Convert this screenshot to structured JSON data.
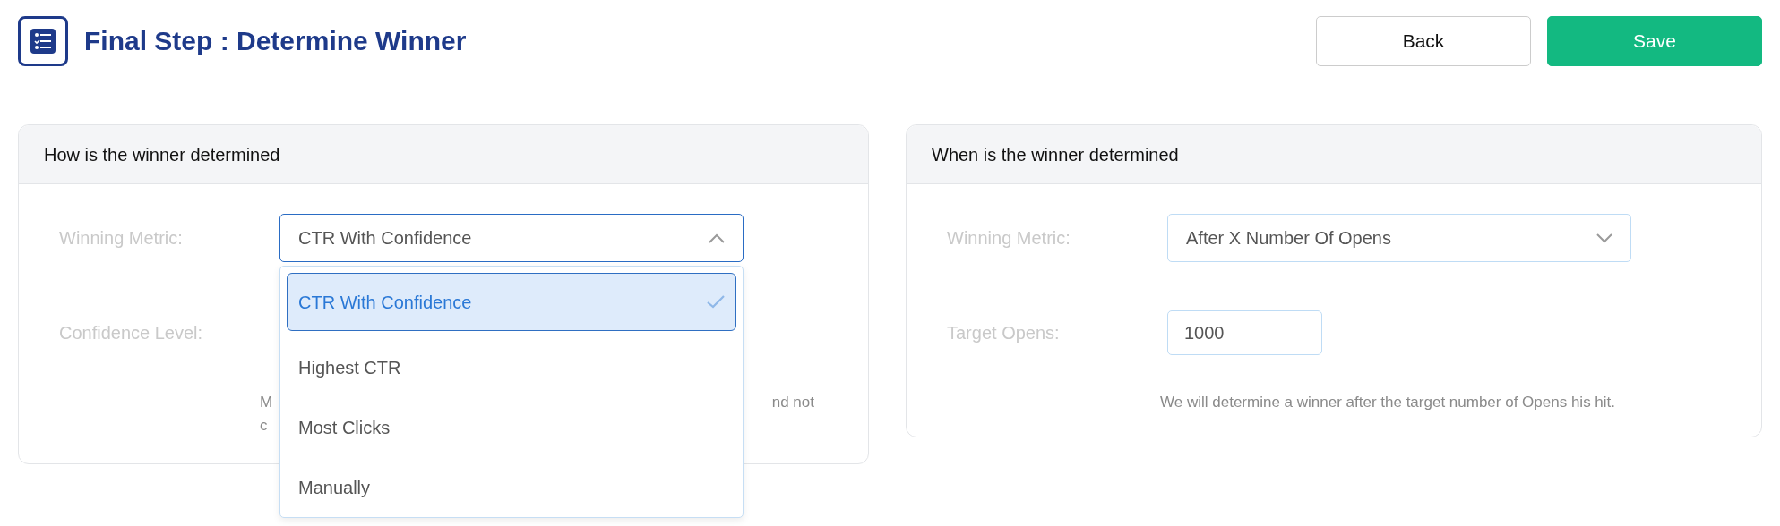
{
  "page": {
    "title": "Final Step : Determine Winner"
  },
  "buttons": [
    {
      "label": "Back",
      "kind": "secondary"
    },
    {
      "label": "Save",
      "kind": "primary"
    }
  ],
  "panels": [
    {
      "title": "How is the winner determined",
      "fields": [
        {
          "kind": "select",
          "label": "Winning Metric:",
          "value": "CTR With Confidence",
          "expanded": true,
          "options": [
            {
              "label": "CTR With Confidence",
              "selected": true
            },
            {
              "label": "Highest CTR",
              "selected": false
            },
            {
              "label": "Most Clicks",
              "selected": false
            },
            {
              "label": "Manually",
              "selected": false
            }
          ]
        },
        {
          "kind": "covered",
          "label": "Confidence Level:"
        }
      ],
      "help_covered": {
        "line_1_start": "M",
        "line_1_end": "nd not",
        "line_2_start": "c"
      }
    },
    {
      "title": "When is the winner determined",
      "fields": [
        {
          "kind": "select",
          "label": "Winning Metric:",
          "value": "After X Number Of Opens",
          "expanded": false
        },
        {
          "kind": "input",
          "label": "Target Opens:",
          "value": "1000"
        }
      ],
      "help": "We will determine a winner after the target number of Opens his hit."
    }
  ]
}
